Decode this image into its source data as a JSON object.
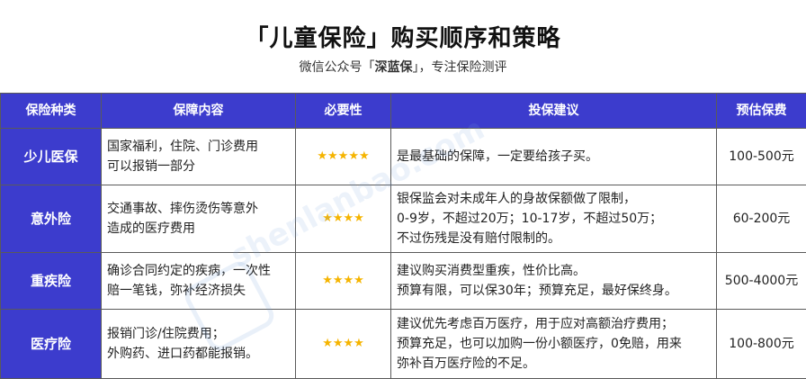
{
  "header": {
    "title": "「儿童保险」购买顺序和策略",
    "subtitle_prefix": "微信公众号「",
    "subtitle_brand": "深蓝保",
    "subtitle_suffix": "」，专注保险测评"
  },
  "watermark": {
    "text": "shenlanbao.com"
  },
  "colors": {
    "header_bg": "#3c3ccd",
    "star": "#f5b400",
    "border": "#5a5a5a"
  },
  "table": {
    "headers": [
      "保险种类",
      "保障内容",
      "必要性",
      "投保建议",
      "预估保费"
    ],
    "rows": [
      {
        "type": "少儿医保",
        "coverage": [
          "国家福利，住院、门诊费用",
          "可以报销一部分"
        ],
        "stars": "★★★★★",
        "advice": [
          "是最基础的保障，一定要给孩子买。"
        ],
        "price": "100-500元"
      },
      {
        "type": "意外险",
        "coverage": [
          "交通事故、摔伤烫伤等意外",
          "造成的医疗费用"
        ],
        "stars": "★★★★",
        "advice": [
          "银保监会对未成年人的身故保额做了限制，",
          "0-9岁，不超过20万；10-17岁，不超过50万；",
          "不过伤残是没有赔付限制的。"
        ],
        "price": "60-200元"
      },
      {
        "type": "重疾险",
        "coverage": [
          "确诊合同约定的疾病，一次性",
          "赔一笔钱，弥补经济损失"
        ],
        "stars": "★★★★",
        "advice": [
          "建议购买消费型重疾，性价比高。",
          "预算有限，可以保30年；预算充足，最好保终身。"
        ],
        "price": "500-4000元"
      },
      {
        "type": "医疗险",
        "coverage": [
          "报销门诊/住院费用；",
          "外购药、进口药都能报销。"
        ],
        "stars": "★★★★",
        "advice": [
          "建议优先考虑百万医疗，用于应对高额治疗费用；",
          "预算充足，也可以加购一份小额医疗，0免赔，用来",
          "弥补百万医疗险的不足。"
        ],
        "price": "100-800元"
      }
    ]
  }
}
